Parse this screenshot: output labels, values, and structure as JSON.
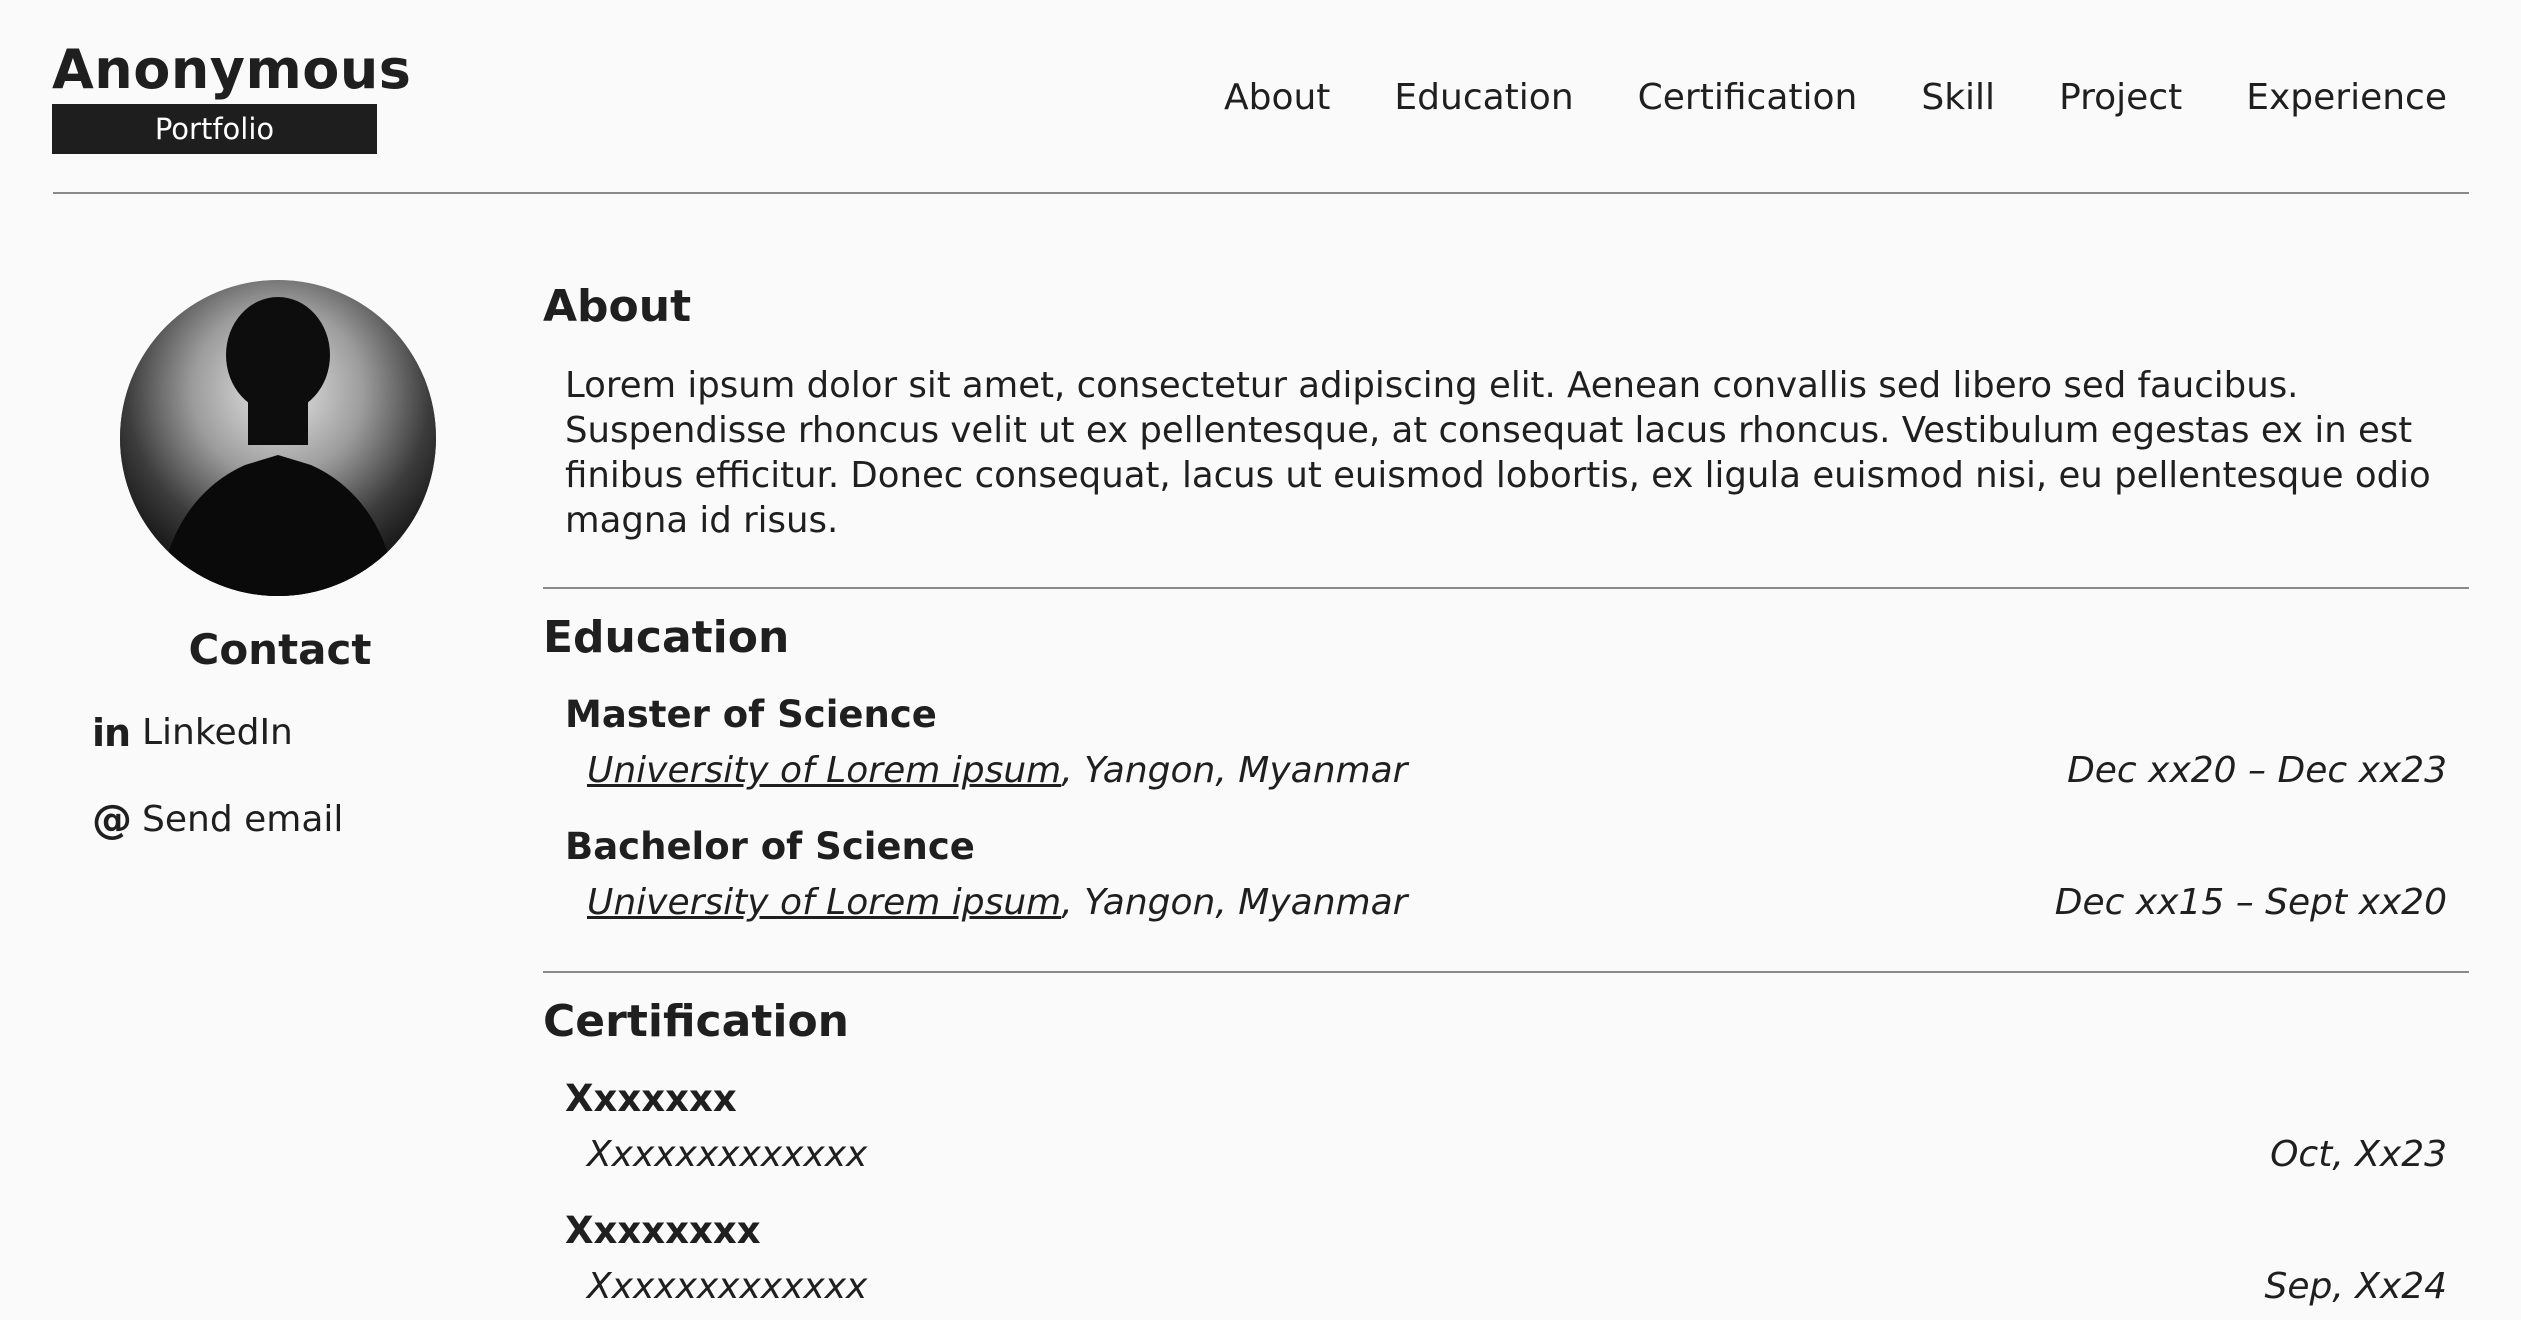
{
  "brand": {
    "title": "Anonymous",
    "subtitle": "Portfolio"
  },
  "nav": {
    "items": [
      {
        "label": "About"
      },
      {
        "label": "Education"
      },
      {
        "label": "Certification"
      },
      {
        "label": "Skill"
      },
      {
        "label": "Project"
      },
      {
        "label": "Experience"
      }
    ]
  },
  "sidebar": {
    "contact_title": "Contact",
    "links": [
      {
        "icon": "linkedin-icon",
        "glyph": "in",
        "label": "LinkedIn"
      },
      {
        "icon": "at-icon",
        "glyph": "@",
        "label": "Send email"
      }
    ]
  },
  "about": {
    "title": "About",
    "text": "Lorem ipsum dolor sit amet, consectetur adipiscing elit. Aenean convallis sed libero sed faucibus. Suspendisse rhoncus velit ut ex pellentesque, at consequat lacus rhoncus. Vestibulum egestas ex in est finibus efficitur. Donec consequat, lacus ut euismod lobortis, ex ligula euismod nisi, eu pellentesque odio magna id risus."
  },
  "education": {
    "title": "Education",
    "entries": [
      {
        "degree": "Master of Science",
        "institution": "University of Lorem ipsum",
        "location": ", Yangon, Myanmar",
        "dates": "Dec xx20 – Dec xx23"
      },
      {
        "degree": "Bachelor of Science",
        "institution": "University of Lorem ipsum",
        "location": ", Yangon, Myanmar",
        "dates": "Dec xx15 – Sept xx20"
      }
    ]
  },
  "certification": {
    "title": "Certification",
    "entries": [
      {
        "name": "Xxxxxxx",
        "issuer": "Xxxxxxxxxxxxx",
        "date": "Oct, Xx23"
      },
      {
        "name": "Xxxxxxxx",
        "issuer": "Xxxxxxxxxxxxx",
        "date": "Sep, Xx24"
      }
    ]
  }
}
